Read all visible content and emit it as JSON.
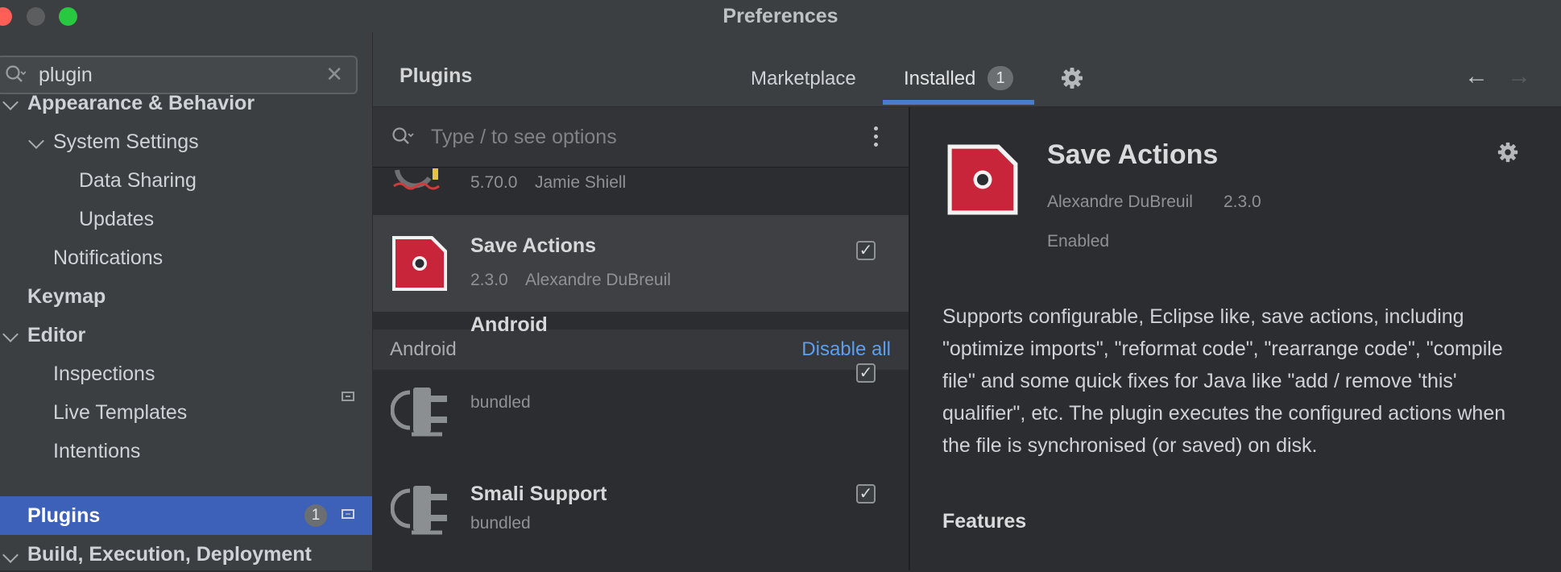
{
  "window": {
    "title": "Preferences"
  },
  "sidebar": {
    "search": {
      "value": "plugin"
    },
    "tree": {
      "appearance": "Appearance & Behavior",
      "system_settings": "System Settings",
      "data_sharing": "Data Sharing",
      "updates": "Updates",
      "notifications": "Notifications",
      "keymap": "Keymap",
      "editor": "Editor",
      "inspections": "Inspections",
      "live_templates": "Live Templates",
      "intentions": "Intentions",
      "plugins": "Plugins",
      "plugins_badge": "1",
      "build": "Build, Execution, Deployment"
    }
  },
  "header": {
    "title": "Plugins",
    "tabs": {
      "marketplace": "Marketplace",
      "installed": "Installed",
      "installed_badge": "1"
    }
  },
  "list": {
    "search_placeholder": "Type / to see options",
    "partial_item": {
      "version": "5.70.0",
      "vendor": "Jamie Shiell"
    },
    "selected_item": {
      "name": "Save Actions",
      "version": "2.3.0",
      "vendor": "Alexandre DuBreuil",
      "enabled": true
    },
    "section": {
      "name": "Android",
      "action": "Disable all"
    },
    "android_items": [
      {
        "name": "Android",
        "meta": "bundled",
        "enabled": true
      },
      {
        "name": "Smali Support",
        "meta": "bundled",
        "enabled": true
      }
    ]
  },
  "details": {
    "title": "Save Actions",
    "vendor": "Alexandre DuBreuil",
    "version": "2.3.0",
    "status": "Enabled",
    "description": "Supports configurable, Eclipse like, save actions, including \"optimize imports\", \"reformat code\", \"rearrange code\", \"compile file\" and some quick fixes for Java like \"add / remove 'this' qualifier\", etc. The plugin executes the configured actions when the file is synchronised (or saved) on disk.",
    "features_heading": "Features"
  },
  "colors": {
    "accent": "#3d61b8",
    "link": "#5c9ff0",
    "tab_underline": "#4a7ccc",
    "plugin_logo": "#c8243a"
  }
}
